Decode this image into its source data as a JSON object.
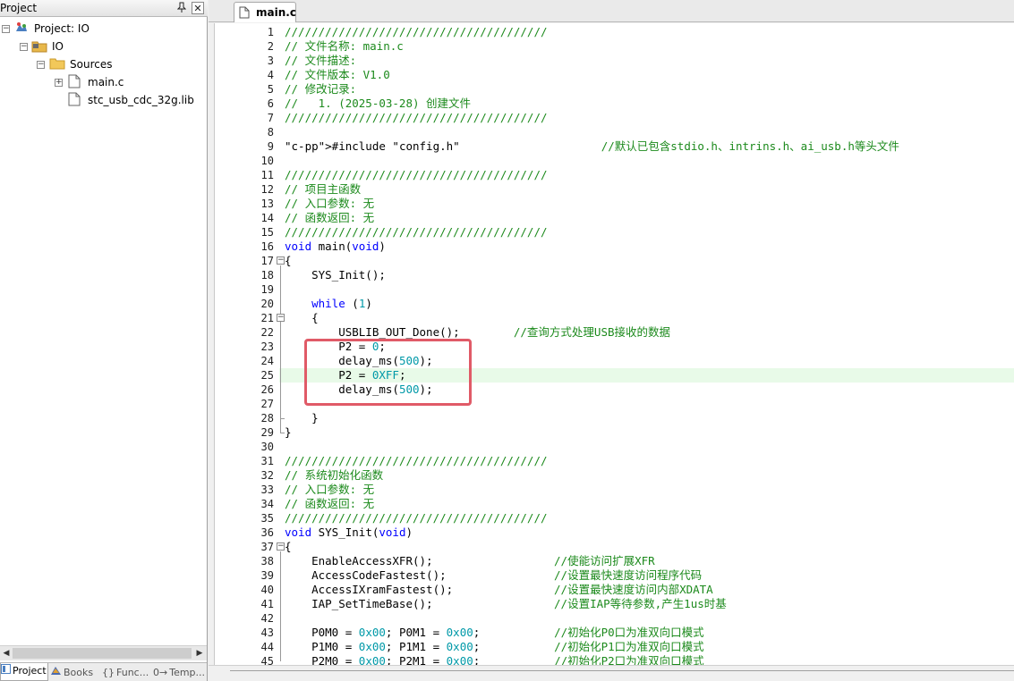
{
  "panel": {
    "title": "Project",
    "pin_glyph": "ᵖ",
    "close_glyph": "✕"
  },
  "tree": {
    "project": "Project: IO",
    "target": "IO",
    "group": "Sources",
    "files": [
      "main.c",
      "stc_usb_cdc_32g.lib"
    ]
  },
  "bottom_tabs": [
    {
      "label": "Project",
      "icon": "project-icon",
      "active": true
    },
    {
      "label": "Books",
      "icon": "books-icon",
      "active": false
    },
    {
      "label": "Func...",
      "icon": "functions-icon",
      "glyph": "{}",
      "active": false
    },
    {
      "label": "Temp...",
      "icon": "templates-icon",
      "glyph": "0→",
      "active": false
    }
  ],
  "editor": {
    "tab_label": "main.c",
    "highlighted_line": 25,
    "lines": [
      {
        "n": 1,
        "text": "///////////////////////////////////////"
      },
      {
        "n": 2,
        "text": "// 文件名称: main.c"
      },
      {
        "n": 3,
        "text": "// 文件描述:"
      },
      {
        "n": 4,
        "text": "// 文件版本: V1.0"
      },
      {
        "n": 5,
        "text": "// 修改记录:"
      },
      {
        "n": 6,
        "text": "//   1. (2025-03-28) 创建文件"
      },
      {
        "n": 7,
        "text": "///////////////////////////////////////"
      },
      {
        "n": 8,
        "text": ""
      },
      {
        "n": 9,
        "text": "#include \"config.h\"                     //默认已包含stdio.h、intrins.h、ai_usb.h等头文件"
      },
      {
        "n": 10,
        "text": ""
      },
      {
        "n": 11,
        "text": "///////////////////////////////////////"
      },
      {
        "n": 12,
        "text": "// 项目主函数"
      },
      {
        "n": 13,
        "text": "// 入口参数: 无"
      },
      {
        "n": 14,
        "text": "// 函数返回: 无"
      },
      {
        "n": 15,
        "text": "///////////////////////////////////////"
      },
      {
        "n": 16,
        "text": "void main(void)"
      },
      {
        "n": 17,
        "text": "{"
      },
      {
        "n": 18,
        "text": "    SYS_Init();"
      },
      {
        "n": 19,
        "text": ""
      },
      {
        "n": 20,
        "text": "    while (1)"
      },
      {
        "n": 21,
        "text": "    {"
      },
      {
        "n": 22,
        "text": "        USBLIB_OUT_Done();        //查询方式处理USB接收的数据"
      },
      {
        "n": 23,
        "text": "        P2 = 0;"
      },
      {
        "n": 24,
        "text": "        delay_ms(500);"
      },
      {
        "n": 25,
        "text": "        P2 = 0XFF;"
      },
      {
        "n": 26,
        "text": "        delay_ms(500);"
      },
      {
        "n": 27,
        "text": ""
      },
      {
        "n": 28,
        "text": "    }"
      },
      {
        "n": 29,
        "text": "}"
      },
      {
        "n": 30,
        "text": ""
      },
      {
        "n": 31,
        "text": "///////////////////////////////////////"
      },
      {
        "n": 32,
        "text": "// 系统初始化函数"
      },
      {
        "n": 33,
        "text": "// 入口参数: 无"
      },
      {
        "n": 34,
        "text": "// 函数返回: 无"
      },
      {
        "n": 35,
        "text": "///////////////////////////////////////"
      },
      {
        "n": 36,
        "text": "void SYS_Init(void)"
      },
      {
        "n": 37,
        "text": "{"
      },
      {
        "n": 38,
        "text": "    EnableAccessXFR();                  //使能访问扩展XFR"
      },
      {
        "n": 39,
        "text": "    AccessCodeFastest();                //设置最快速度访问程序代码"
      },
      {
        "n": 40,
        "text": "    AccessIXramFastest();               //设置最快速度访问内部XDATA"
      },
      {
        "n": 41,
        "text": "    IAP_SetTimeBase();                  //设置IAP等待参数,产生1us时基"
      },
      {
        "n": 42,
        "text": ""
      },
      {
        "n": 43,
        "text": "    P0M0 = 0x00; P0M1 = 0x00;           //初始化P0口为准双向口模式"
      },
      {
        "n": 44,
        "text": "    P1M0 = 0x00; P1M1 = 0x00;           //初始化P1口为准双向口模式"
      },
      {
        "n": 45,
        "text": "    P2M0 = 0x00; P2M1 = 0x00;           //初始化P2口为准双向口模式"
      }
    ]
  },
  "colors": {
    "comment": "#1c8a1c",
    "keyword": "#0000ff",
    "preprocessor": "#7f3f00",
    "string": "#a31515",
    "number": "#0099a8",
    "annotation_box": "#e05a67",
    "current_line": "#e8fae8"
  }
}
